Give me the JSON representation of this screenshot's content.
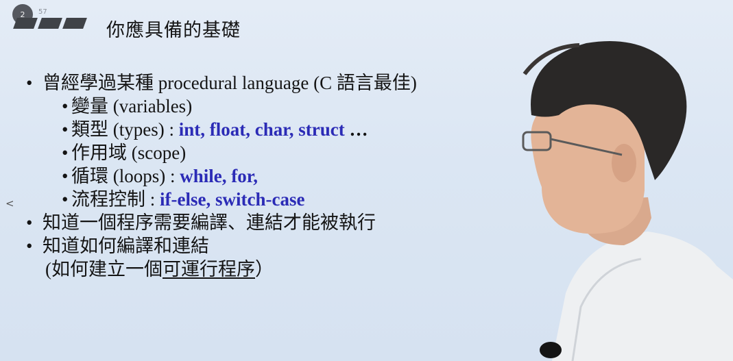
{
  "slide": {
    "page_number": "2",
    "page_total": "57",
    "title": "你應具備的基礎",
    "prev_arrow": "<"
  },
  "bullets": [
    {
      "marker": "•",
      "text": "曾經學過某種 procedural language (C 語言最佳)"
    },
    {
      "marker": "•",
      "label": "變量 (variables)",
      "keywords": ""
    },
    {
      "marker": "•",
      "label": "類型 (types) : ",
      "keywords": "int, float, char, struct",
      "suffix": " …"
    },
    {
      "marker": "•",
      "label": "作用域 (scope)",
      "keywords": ""
    },
    {
      "marker": "•",
      "label": "循環 (loops) : ",
      "keywords": "while, for,"
    },
    {
      "marker": "•",
      "label": "流程控制 : ",
      "keywords": "if-else, switch-case"
    },
    {
      "marker": "•",
      "text": "知道一個程序需要編譯、連結才能被執行"
    },
    {
      "marker": "•",
      "text": "知道如何編譯和連結"
    },
    {
      "text_open": "(如何建立一個",
      "text_underlined": "可運行程序",
      "text_close": "）"
    }
  ],
  "colors": {
    "keyword": "#2b2bb6",
    "background": "#dce6f3"
  }
}
